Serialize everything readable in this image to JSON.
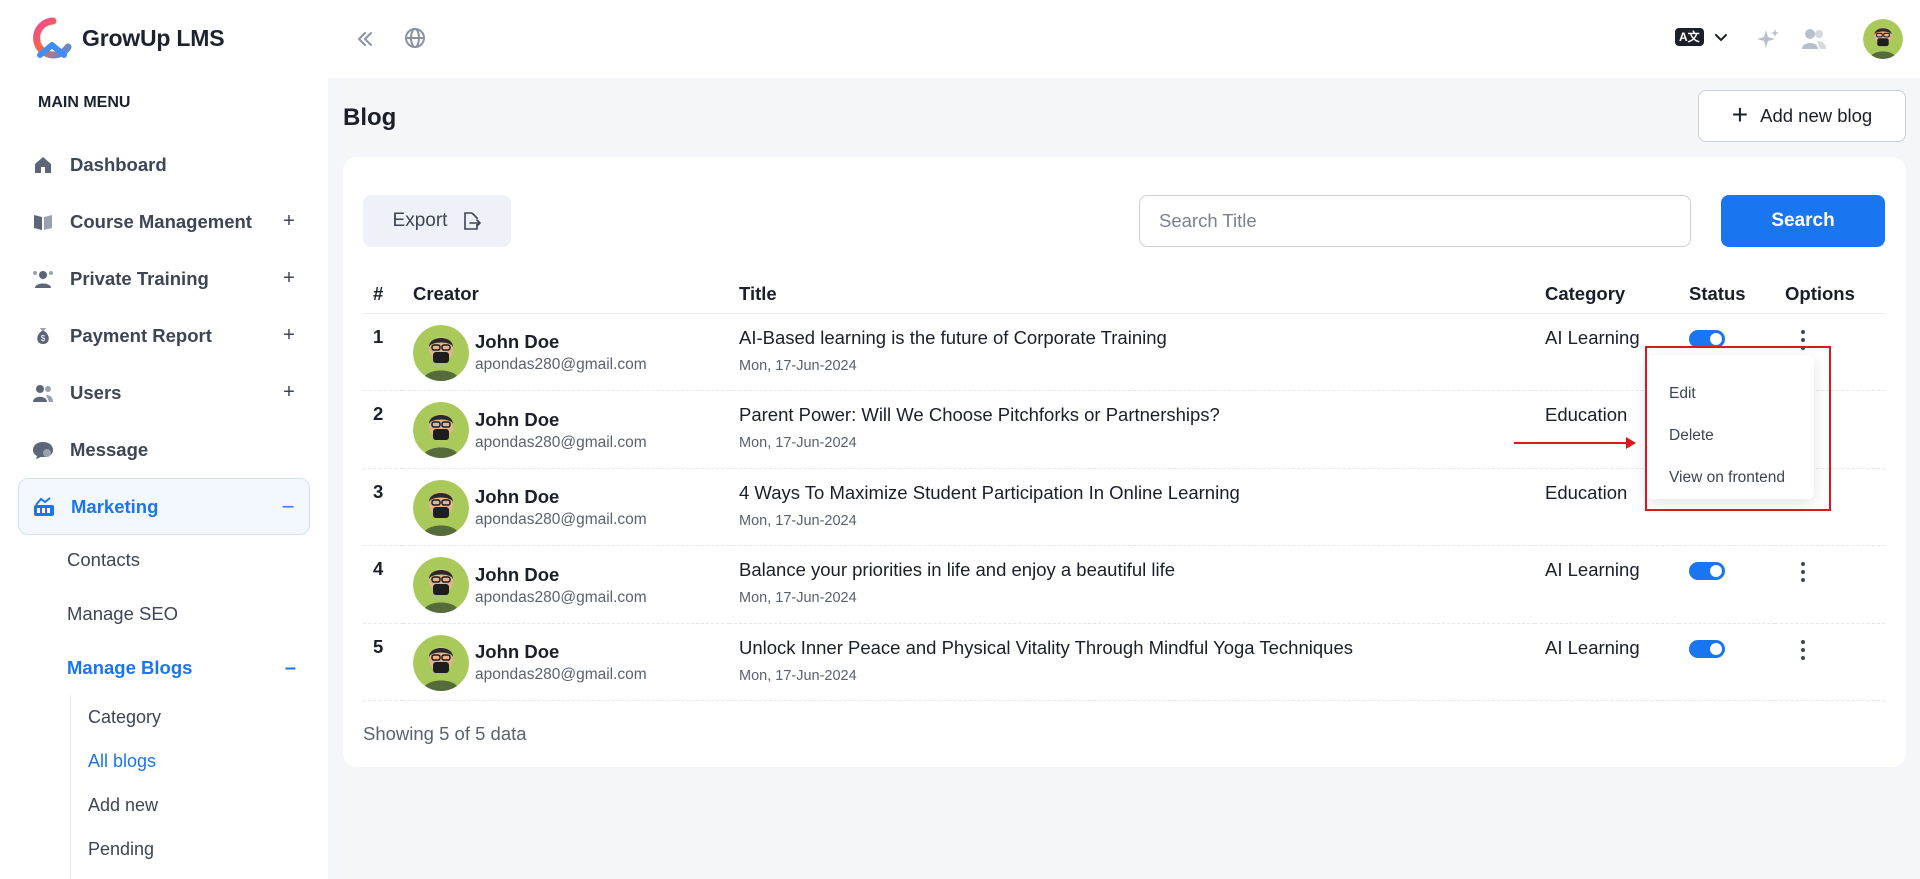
{
  "app": {
    "name": "GrowUp LMS",
    "accent": "#1a76f0",
    "annotation_color": "#e0161e"
  },
  "sidebar": {
    "heading": "MAIN MENU",
    "items": [
      {
        "label": "Dashboard",
        "icon": "home-icon",
        "toggle": ""
      },
      {
        "label": "Course Management",
        "icon": "book-icon",
        "toggle": "+"
      },
      {
        "label": "Private Training",
        "icon": "training-icon",
        "toggle": "+"
      },
      {
        "label": "Payment Report",
        "icon": "money-bag-icon",
        "toggle": "+"
      },
      {
        "label": "Users",
        "icon": "users-icon",
        "toggle": "+"
      },
      {
        "label": "Message",
        "icon": "message-icon",
        "toggle": ""
      },
      {
        "label": "Marketing",
        "icon": "marketing-icon",
        "toggle": "–"
      }
    ],
    "marketing_sub": [
      {
        "label": "Contacts",
        "toggle": ""
      },
      {
        "label": "Manage SEO",
        "toggle": ""
      },
      {
        "label": "Manage Blogs",
        "toggle": "–"
      }
    ],
    "blogs_sub": [
      {
        "label": "Category"
      },
      {
        "label": "All blogs"
      },
      {
        "label": "Add new"
      },
      {
        "label": "Pending"
      }
    ]
  },
  "topbar": {
    "lang_badge": "A文"
  },
  "page": {
    "title": "Blog",
    "add_button": "Add new blog"
  },
  "toolbar": {
    "export_label": "Export",
    "search_placeholder": "Search Title",
    "search_label": "Search"
  },
  "table": {
    "headers": [
      "#",
      "Creator",
      "Title",
      "Category",
      "Status",
      "Options"
    ],
    "rows": [
      {
        "num": "1",
        "name": "John Doe",
        "email": "apondas280@gmail.com",
        "title": "AI-Based learning is the future of Corporate Training",
        "date": "Mon, 17-Jun-2024",
        "category": "AI Learning",
        "status": "on"
      },
      {
        "num": "2",
        "name": "John Doe",
        "email": "apondas280@gmail.com",
        "title": "Parent Power: Will We Choose Pitchforks or Partnerships?",
        "date": "Mon, 17-Jun-2024",
        "category": "Education",
        "status": "on"
      },
      {
        "num": "3",
        "name": "John Doe",
        "email": "apondas280@gmail.com",
        "title": "4 Ways To Maximize Student Participation In Online Learning",
        "date": "Mon, 17-Jun-2024",
        "category": "Education",
        "status": "on"
      },
      {
        "num": "4",
        "name": "John Doe",
        "email": "apondas280@gmail.com",
        "title": "Balance your priorities in life and enjoy a beautiful life",
        "date": "Mon, 17-Jun-2024",
        "category": "AI Learning",
        "status": "on"
      },
      {
        "num": "5",
        "name": "John Doe",
        "email": "apondas280@gmail.com",
        "title": "Unlock Inner Peace and Physical Vitality Through Mindful Yoga Techniques",
        "date": "Mon, 17-Jun-2024",
        "category": "AI Learning",
        "status": "on"
      }
    ],
    "footer": "Showing 5 of 5 data"
  },
  "dropdown": {
    "options": [
      "Edit",
      "Delete",
      "View on frontend"
    ]
  }
}
